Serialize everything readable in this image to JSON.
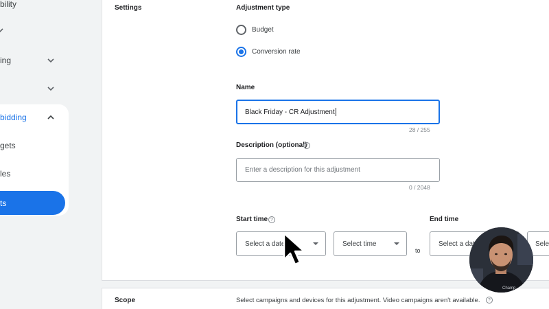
{
  "sidebar": {
    "items": [
      {
        "label": "bility",
        "chevron": false
      },
      {
        "label": "",
        "chevron": false
      },
      {
        "label": "ing",
        "chevron": true
      },
      {
        "label": "",
        "chevron": true
      },
      {
        "label": "bidding",
        "chevron": true
      },
      {
        "label": "gets",
        "chevron": false
      },
      {
        "label": "les",
        "chevron": false
      },
      {
        "label": "ts",
        "chevron": false
      }
    ]
  },
  "settings": {
    "section_label": "Settings",
    "adjustment_type_label": "Adjustment type",
    "options": [
      {
        "label": "Budget",
        "selected": false
      },
      {
        "label": "Conversion rate",
        "selected": true
      }
    ],
    "name_label": "Name",
    "name_value": "Black Friday - CR Adjustment",
    "name_counter": "28 / 255",
    "description_label": "Description (optional)",
    "description_placeholder": "Enter a description for this adjustment",
    "description_counter": "0 / 2048",
    "start_time_label": "Start time",
    "end_time_label": "End time",
    "select_date": "Select a date",
    "select_time": "Select time",
    "to_label": "to",
    "end_select_partial": "Selec"
  },
  "scope": {
    "section_label": "Scope",
    "description": "Select campaigns and devices for this adjustment. Video campaigns aren't available."
  },
  "webcam": {
    "caption": "Champ"
  },
  "colors": {
    "accent": "#1a73e8",
    "background": "#f1f3f4",
    "card": "#ffffff"
  }
}
